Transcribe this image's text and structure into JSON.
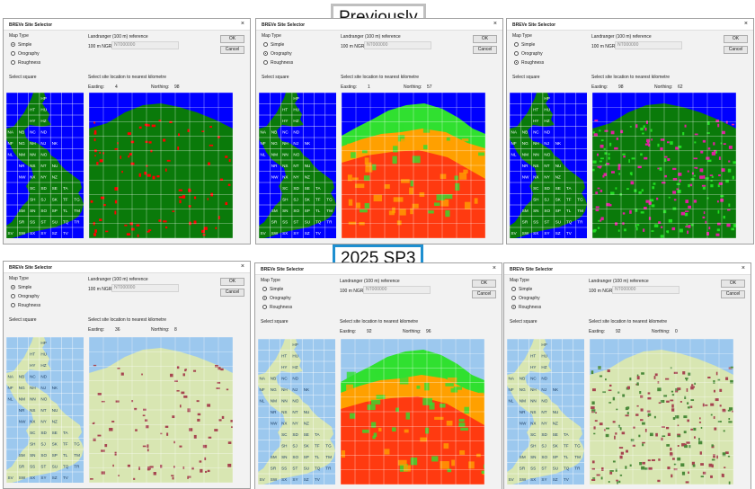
{
  "banners": {
    "previously": "Previously",
    "new": "2025 SP3"
  },
  "common": {
    "window_title": "BREVe Site Selector",
    "close_glyph": "×",
    "map_type_label": "Map Type",
    "options": [
      "Simple",
      "Orography",
      "Roughness"
    ],
    "landranger_label": "Landranger (100 m) reference",
    "ngr_label": "100 m NGR",
    "ngr_value": "NT000000",
    "ok_label": "OK",
    "cancel_label": "Cancel",
    "select_square_label": "Select square",
    "select_site_label": "Select site location to nearest kilometre",
    "easting_label": "Easting:",
    "northing_label": "Northing:"
  },
  "grid_labels": [
    [
      "",
      "",
      "",
      "HP",
      ""
    ],
    [
      "",
      "",
      "HT",
      "HU",
      ""
    ],
    [
      "",
      "",
      "HY",
      "HZ",
      ""
    ],
    [
      "NA",
      "NB",
      "NC",
      "ND",
      ""
    ],
    [
      "NF",
      "NG",
      "NH",
      "NJ",
      "NK"
    ],
    [
      "NL",
      "NM",
      "NN",
      "NO",
      ""
    ],
    [
      "",
      "NR",
      "NS",
      "NT",
      "NU"
    ],
    [
      "",
      "NW",
      "NX",
      "NY",
      "NZ"
    ],
    [
      "",
      "",
      "SC",
      "SD",
      "SE",
      "TA"
    ],
    [
      "",
      "",
      "SH",
      "SJ",
      "SK",
      "TF",
      "TG"
    ],
    [
      "",
      "SM",
      "SN",
      "SO",
      "SP",
      "TL",
      "TM"
    ],
    [
      "",
      "SR",
      "SS",
      "ST",
      "SU",
      "TQ",
      "TR"
    ],
    [
      "SV",
      "SW",
      "SX",
      "SY",
      "SZ",
      "TV",
      ""
    ]
  ],
  "colors": {
    "old_sea": "#0000ff",
    "old_land": "#0a7a0a",
    "old_urban": "#ff0000",
    "new_sea": "#9cc8ee",
    "new_land": "#d8e6b2",
    "new_urban": "#a64550",
    "new_forest": "#4a8a3a",
    "orog_low": "#ff3a10",
    "orog_mid": "#ffa000",
    "orog_high": "#30e030"
  },
  "dialogs": [
    {
      "id": "old-simple",
      "selected": 0,
      "easting": "4",
      "northing": "98"
    },
    {
      "id": "old-orography",
      "selected": 1,
      "easting": "1",
      "northing": "57"
    },
    {
      "id": "old-roughness",
      "selected": 2,
      "easting": "98",
      "northing": "62"
    },
    {
      "id": "new-simple",
      "selected": 0,
      "easting": "36",
      "northing": "8"
    },
    {
      "id": "new-orography",
      "selected": 1,
      "easting": "92",
      "northing": "96"
    },
    {
      "id": "new-roughness",
      "selected": 2,
      "easting": "92",
      "northing": "0"
    }
  ]
}
